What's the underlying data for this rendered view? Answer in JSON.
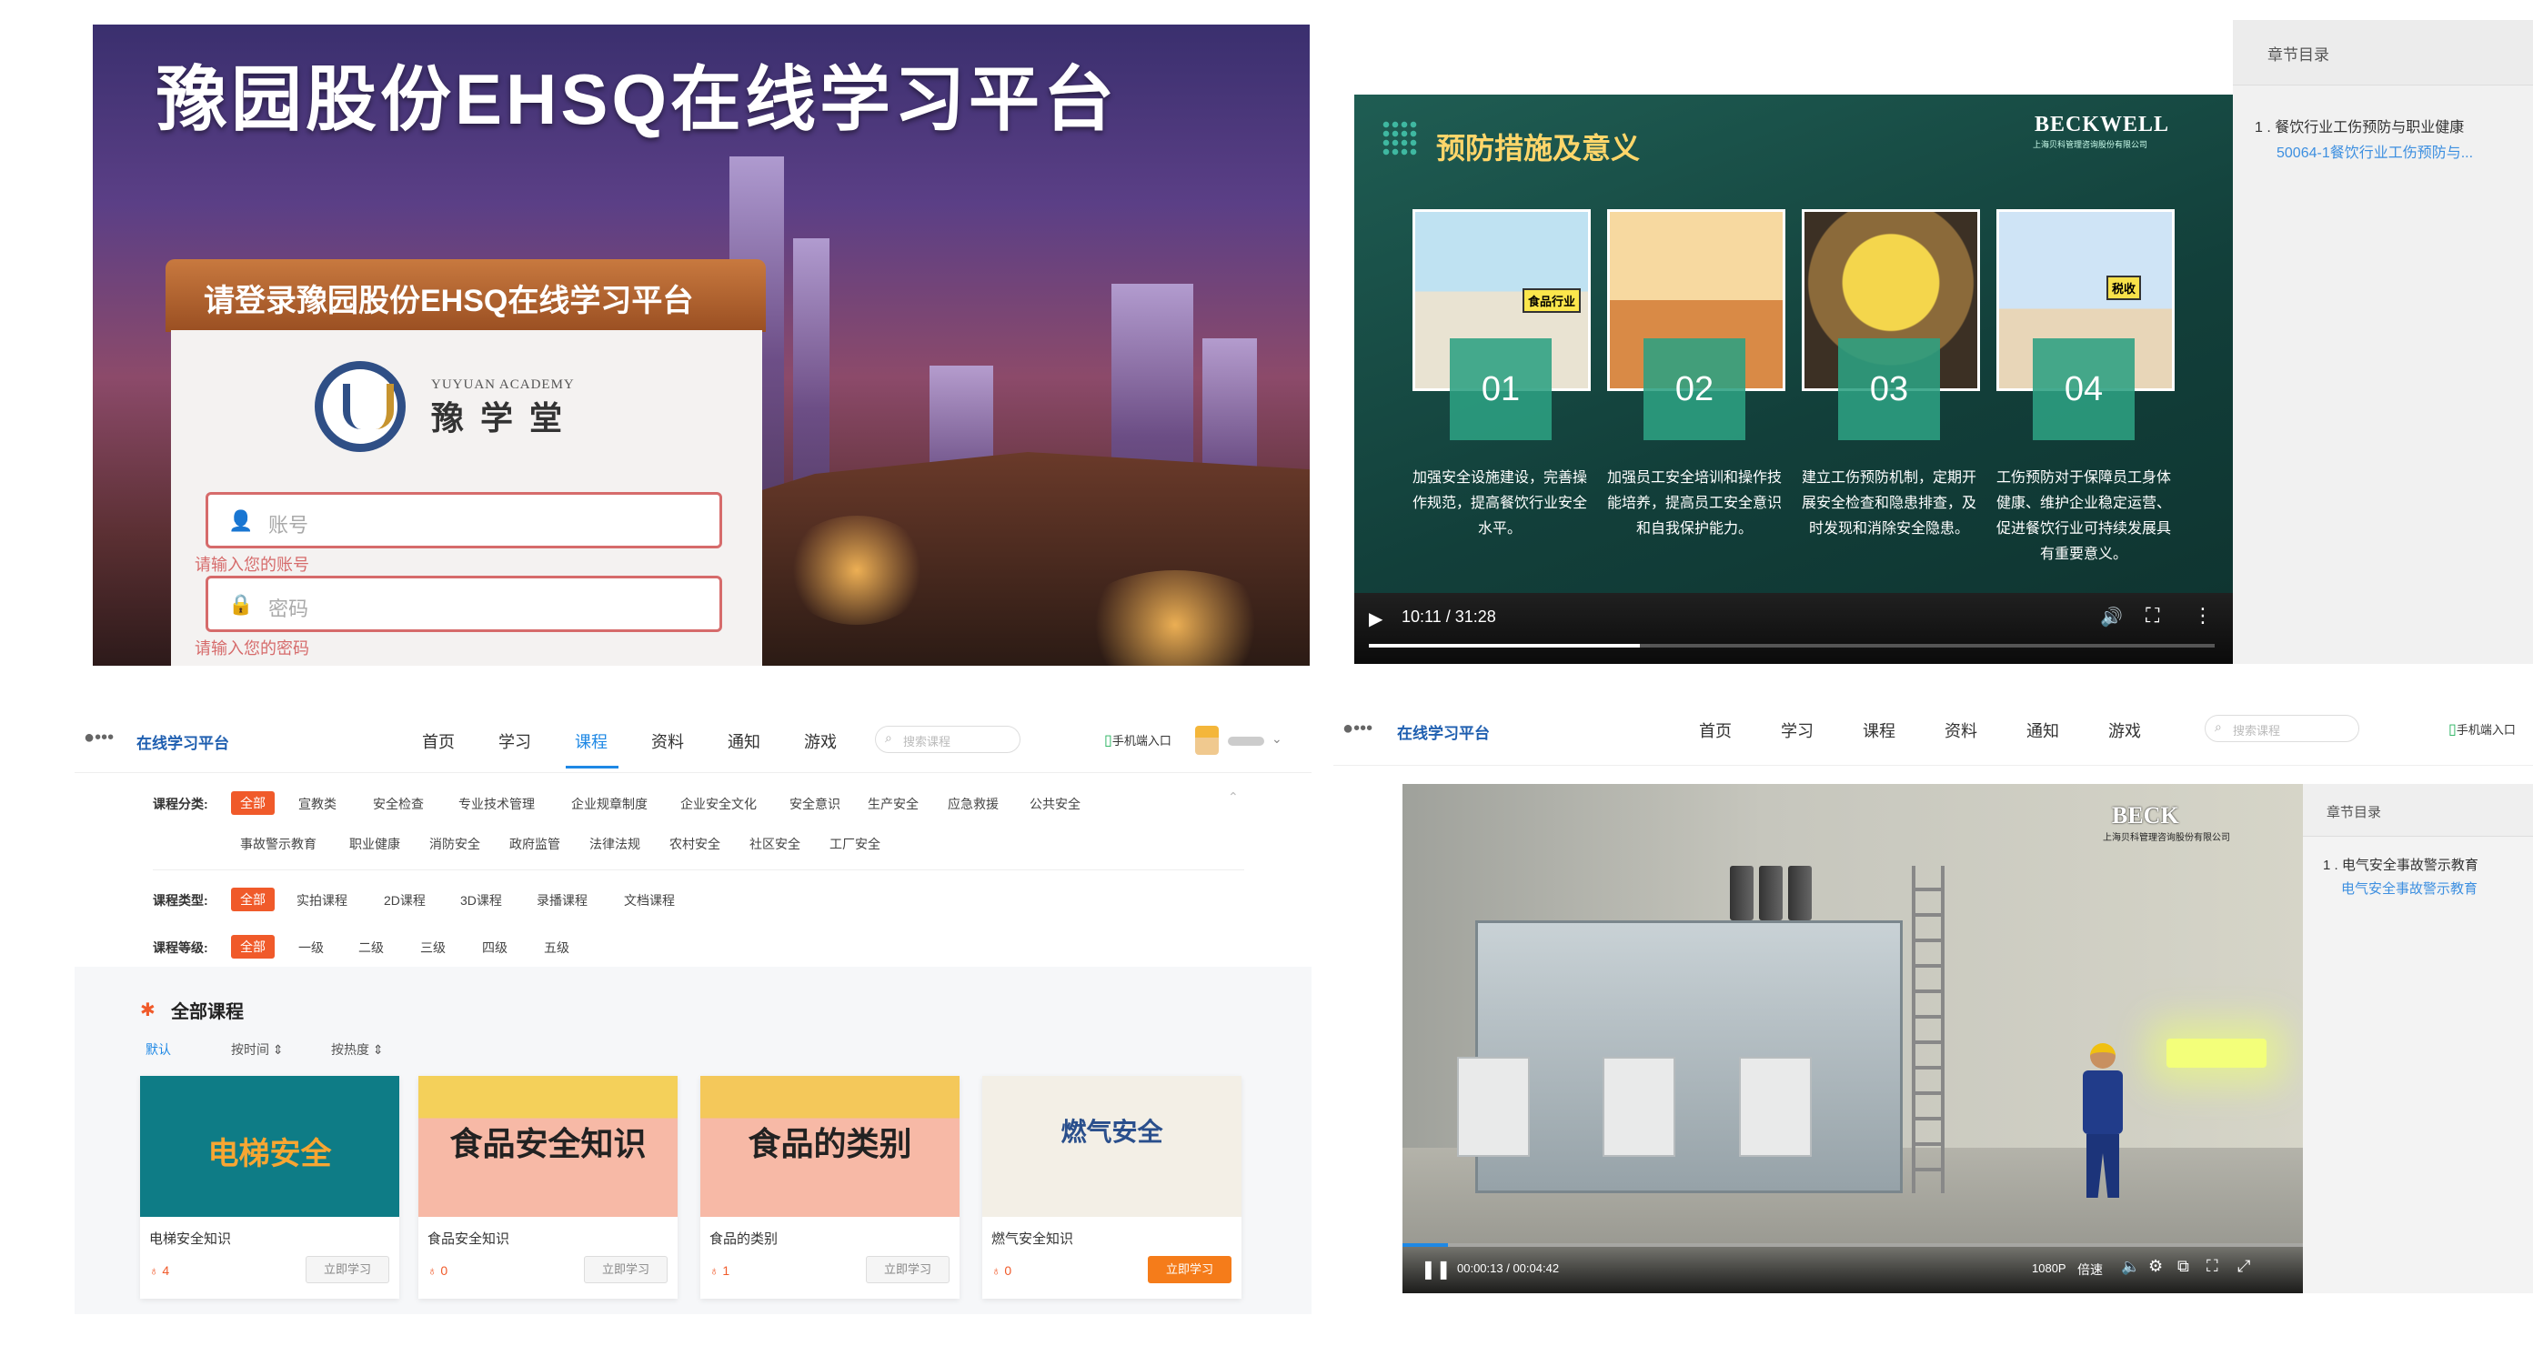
{
  "login_panel": {
    "title": "豫园股份EHSQ在线学习平台",
    "banner": "请登录豫园股份EHSQ在线学习平台",
    "logo_en": "YUYUAN ACADEMY",
    "logo_cn": "豫学堂",
    "account_placeholder": "账号",
    "account_error": "请输入您的账号",
    "password_placeholder": "密码",
    "password_error": "请输入您的密码",
    "icons": {
      "user": "user-icon",
      "lock": "lock-icon"
    }
  },
  "video_panel_1": {
    "slide_title": "预防措施及意义",
    "brand": "BECKWELL",
    "brand_sub": "上海贝科管理咨询股份有限公司",
    "cards": [
      {
        "num": "01",
        "scene_label": "食品行业",
        "desc": "加强安全设施建设，完善操作规范，提高餐饮行业安全水平。"
      },
      {
        "num": "02",
        "desc": "加强员工安全培训和操作技能培养，提高员工安全意识和自我保护能力。"
      },
      {
        "num": "03",
        "desc": "建立工伤预防机制，定期开展安全检查和隐患排查，及时发现和消除安全隐患。"
      },
      {
        "num": "04",
        "scene_label": "税收",
        "desc": "工伤预防对于保障员工身体健康、维护企业稳定运营、促进餐饮行业可持续发展具有重要意义。"
      }
    ],
    "time": "10:11 / 31:28",
    "progress": 0.32,
    "sidebar": {
      "header": "章节目录",
      "chapter": "1 . 餐饮行业工伤预防与职业健康",
      "lesson": "50064-1餐饮行业工伤预防与..."
    }
  },
  "course_panel": {
    "brand": "在线学习平台",
    "nav": [
      "首页",
      "学习",
      "课程",
      "资料",
      "通知",
      "游戏"
    ],
    "active_nav": "课程",
    "search_placeholder": "搜索课程",
    "mobile_entry": "手机端入口",
    "filters": {
      "category_label": "课程分类:",
      "category_row1": [
        "全部",
        "宣教类",
        "安全检查",
        "专业技术管理",
        "企业规章制度",
        "企业安全文化",
        "安全意识",
        "生产安全",
        "应急救援",
        "公共安全"
      ],
      "category_row2": [
        "事故警示教育",
        "职业健康",
        "消防安全",
        "政府监管",
        "法律法规",
        "农村安全",
        "社区安全",
        "工厂安全"
      ],
      "type_label": "课程类型:",
      "types": [
        "全部",
        "实拍课程",
        "2D课程",
        "3D课程",
        "录播课程",
        "文档课程"
      ],
      "level_label": "课程等级:",
      "levels": [
        "全部",
        "一级",
        "二级",
        "三级",
        "四级",
        "五级"
      ]
    },
    "section_title": "全部课程",
    "sort": [
      "默认",
      "按时间 ⇕",
      "按热度 ⇕"
    ],
    "courses": [
      {
        "thumb_title": "电梯安全",
        "name": "电梯安全知识",
        "count": "4",
        "button": "立即学习",
        "color": "#0e7c86"
      },
      {
        "thumb_title": "食品安全知识",
        "name": "食品安全知识",
        "count": "0",
        "button": "立即学习",
        "color": "#f7c9b7"
      },
      {
        "thumb_title": "食品的类别",
        "name": "食品的类别",
        "count": "1",
        "button": "立即学习",
        "color": "#f7c9b7"
      },
      {
        "thumb_title": "燃气安全",
        "name": "燃气安全知识",
        "count": "0",
        "button": "立即学习",
        "color": "#f3efe6"
      }
    ]
  },
  "video_panel_2": {
    "brand": "在线学习平台",
    "nav": [
      "首页",
      "学习",
      "课程",
      "资料",
      "通知",
      "游戏"
    ],
    "search_placeholder": "搜索课程",
    "mobile_entry": "手机端入口",
    "video_brand": "BECK",
    "video_brand_sub": "上海贝科管理咨询股份有限公司",
    "time": "00:00:13 / 00:04:42",
    "quality": "1080P",
    "speed": "倍速",
    "progress": 0.05,
    "sidebar": {
      "header": "章节目录",
      "chapter": "1 . 电气安全事故警示教育",
      "lesson": "电气安全事故警示教育"
    }
  }
}
